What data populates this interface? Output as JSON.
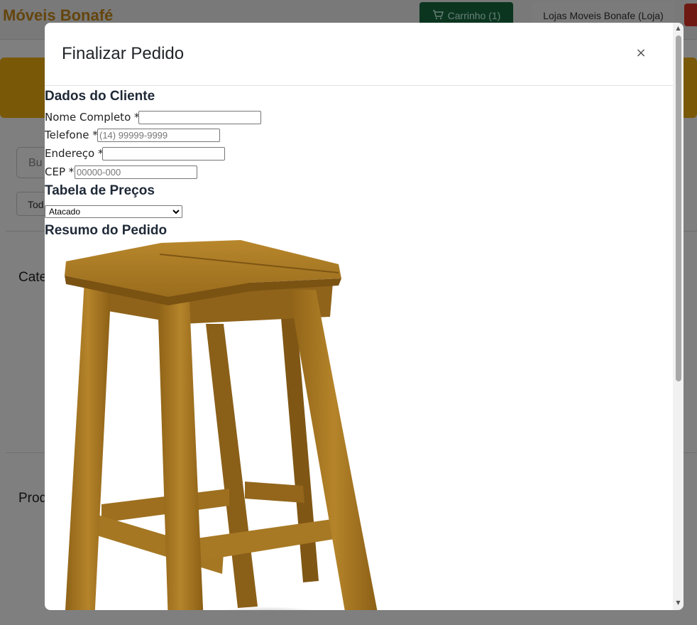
{
  "background": {
    "brand": "Móveis Bonafé",
    "cart_label": "Carrinho (1)",
    "store_label": "Lojas Moveis Bonafe (Loja)",
    "search_placeholder": "Bu",
    "filter_label": "Tod",
    "section_categories": "Cate",
    "section_products": "Prod"
  },
  "modal": {
    "title": "Finalizar Pedido",
    "close_label": "×",
    "customer_section": "Dados do Cliente",
    "fields": {
      "name": {
        "label": "Nome Completo *",
        "value": "",
        "placeholder": ""
      },
      "phone": {
        "label": "Telefone *",
        "value": "",
        "placeholder": "(14) 99999-9999"
      },
      "address": {
        "label": "Endereço *",
        "value": "",
        "placeholder": ""
      },
      "cep": {
        "label": "CEP *",
        "value": "",
        "placeholder": "00000-000"
      }
    },
    "price_table_section": "Tabela de Preços",
    "price_table_selected": "Atacado",
    "summary_section": "Resumo do Pedido"
  },
  "colors": {
    "brand": "#c98a1a",
    "cart_button": "#166b3e",
    "banner": "#f2b00e",
    "wood": "#a9781f"
  },
  "icons": {
    "cart": "cart-icon",
    "close": "close-icon",
    "product_image": "wooden-stool"
  }
}
